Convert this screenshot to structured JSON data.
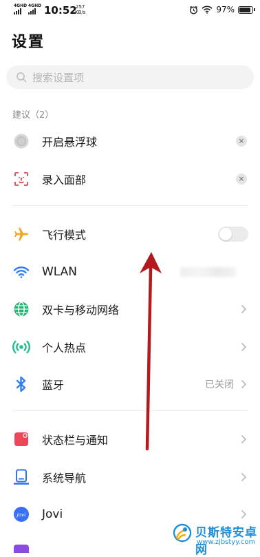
{
  "status_bar": {
    "sim1": "4GHD",
    "sim2": "4GHD",
    "time": "10:52",
    "speed_value": "257",
    "speed_unit": "KB/s",
    "battery_text": "97%",
    "battery_level": 0.97
  },
  "page": {
    "title": "设置"
  },
  "search": {
    "placeholder": "搜索设置项"
  },
  "suggestions": {
    "header": "建议（2）",
    "items": [
      {
        "label": "开启悬浮球",
        "icon": "floating-ball-icon",
        "dismiss": "×"
      },
      {
        "label": "录入面部",
        "icon": "face-scan-icon",
        "dismiss": "×"
      }
    ]
  },
  "network": {
    "items": [
      {
        "label": "飞行模式",
        "icon": "airplane-icon",
        "toggle_on": false
      },
      {
        "label": "WLAN",
        "icon": "wifi-icon"
      },
      {
        "label": "双卡与移动网络",
        "icon": "globe-icon"
      },
      {
        "label": "个人热点",
        "icon": "hotspot-icon"
      },
      {
        "label": "蓝牙",
        "icon": "bluetooth-icon",
        "value": "已关闭"
      }
    ]
  },
  "system": {
    "items": [
      {
        "label": "状态栏与通知",
        "icon": "notification-icon"
      },
      {
        "label": "系统导航",
        "icon": "navigation-icon"
      },
      {
        "label": "Jovi",
        "icon": "jovi-icon",
        "logo_text": "Jovi"
      }
    ]
  },
  "watermark": {
    "title": "贝斯特安卓网",
    "url": "www.zjbstyy.com"
  },
  "colors": {
    "airplane": "#f5a623",
    "wifi": "#2f7cf6",
    "globe": "#22b573",
    "hotspot": "#1fbf8f",
    "bluetooth": "#2f7cf6",
    "notification": "#f0465a",
    "navigation": "#2f6ff0",
    "jovi": "#3a6ff7",
    "arrow": "#b3191d",
    "watermark": "#1e8ed8"
  }
}
